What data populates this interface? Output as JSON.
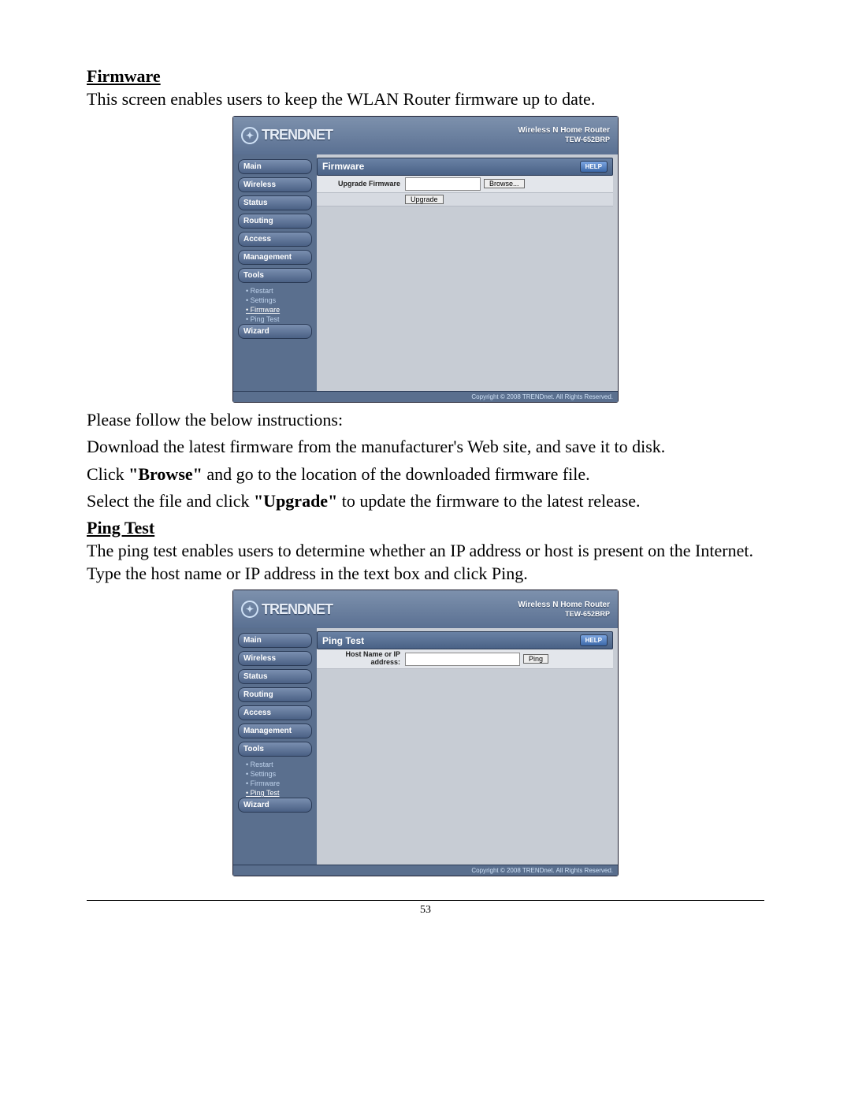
{
  "doc": {
    "firmware_heading": "Firmware",
    "firmware_intro": "This screen enables users to keep the WLAN Router firmware up to date.",
    "instr_lead": "Please follow the below instructions:",
    "instr_1": "Download the latest firmware from the manufacturer's Web site, and save it to disk.",
    "instr_2a": "Click ",
    "instr_2b": "\"Browse\"",
    "instr_2c": " and go to the location of the downloaded firmware file.",
    "instr_3a": "Select the file and click ",
    "instr_3b": "\"Upgrade\"",
    "instr_3c": " to update the firmware to the latest release.",
    "ping_heading": "Ping Test",
    "ping_intro": "The ping test enables users to determine whether an IP address or host is present on the Internet. Type the host name or IP address in the text box and click Ping.",
    "page_number": "53"
  },
  "router": {
    "brand": "TRENDNET",
    "header_title": "Wireless N Home Router",
    "model": "TEW-652BRP",
    "help": "HELP",
    "copyright": "Copyright © 2008 TRENDnet. All Rights Reserved.",
    "nav": {
      "main": "Main",
      "wireless": "Wireless",
      "status": "Status",
      "routing": "Routing",
      "access": "Access",
      "management": "Management",
      "tools": "Tools",
      "wizard": "Wizard",
      "sub_restart": "Restart",
      "sub_settings": "Settings",
      "sub_firmware": "Firmware",
      "sub_ping": "Ping Test"
    },
    "firmware": {
      "title": "Firmware",
      "row_label": "Upgrade Firmware",
      "browse": "Browse...",
      "upgrade": "Upgrade"
    },
    "ping": {
      "title": "Ping Test",
      "row_label": "Host Name or IP address:",
      "ping_btn": "Ping"
    }
  }
}
